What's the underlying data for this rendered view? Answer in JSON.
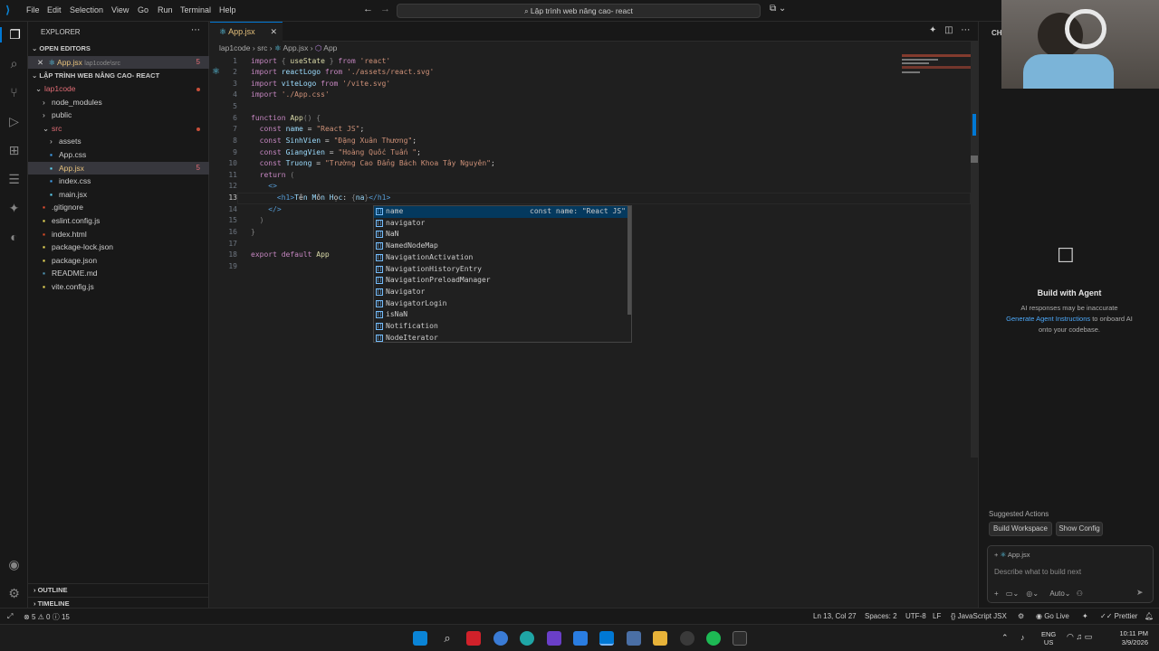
{
  "menu": {
    "items": [
      "File",
      "Edit",
      "Selection",
      "View",
      "Go",
      "Run",
      "Terminal",
      "Help"
    ],
    "search": "Lập trình web nâng cao- react"
  },
  "sidebar": {
    "title": "EXPLORER",
    "open_editors": "OPEN EDITORS",
    "open_file": "App.jsx",
    "open_file_path": "lap1code\\src",
    "open_file_badge": "5",
    "workspace": "LẬP TRÌNH WEB NÂNG CAO- REACT",
    "tree": [
      {
        "label": "lap1code",
        "type": "folder-open",
        "level": 1
      },
      {
        "label": "node_modules",
        "type": "folder",
        "level": 2
      },
      {
        "label": "public",
        "type": "folder",
        "level": 2
      },
      {
        "label": "src",
        "type": "folder-open",
        "level": 2
      },
      {
        "label": "assets",
        "type": "folder",
        "level": 3
      },
      {
        "label": "App.css",
        "type": "css",
        "level": 3
      },
      {
        "label": "App.jsx",
        "type": "jsx",
        "level": 3
      },
      {
        "label": "index.css",
        "type": "css",
        "level": 3
      },
      {
        "label": "main.jsx",
        "type": "jsx",
        "level": 3
      },
      {
        "label": ".gitignore",
        "type": "git",
        "level": 2
      },
      {
        "label": "eslint.config.js",
        "type": "js",
        "level": 2
      },
      {
        "label": "index.html",
        "type": "html",
        "level": 2
      },
      {
        "label": "package-lock.json",
        "type": "json",
        "level": 2
      },
      {
        "label": "package.json",
        "type": "json",
        "level": 2
      },
      {
        "label": "README.md",
        "type": "md",
        "level": 2
      },
      {
        "label": "vite.config.js",
        "type": "js",
        "level": 2
      }
    ],
    "badge": "5",
    "outline": "OUTLINE",
    "timeline": "TIMELINE"
  },
  "editor": {
    "tab": "App.jsx",
    "breadcrumb": [
      "lap1code",
      "src",
      "App.jsx",
      "App"
    ],
    "line_numbers": [
      "1",
      "2",
      "3",
      "4",
      "5",
      "6",
      "7",
      "8",
      "9",
      "10",
      "11",
      "12",
      "13",
      "14",
      "15",
      "16",
      "17",
      "18",
      "19"
    ],
    "code": [
      "import { useState } from 'react'",
      "import reactLogo from './assets/react.svg'",
      "import viteLogo from '/vite.svg'",
      "import './App.css'",
      "",
      "function App() {",
      "  const name = \"React JS\";",
      "  const SinhVien = \"Đặng Xuân Thương\";",
      "  const GiangVien = \"Hoàng Quốc Tuấn \";",
      "  const Truong = \"Trường Cao Đẳng Bách Khoa Tây Nguyên\";",
      "  return (",
      "    <>",
      "      <h1>Tên Môn Học: {na}</h1>",
      "    </>",
      "  )",
      "}",
      "",
      "export default App",
      ""
    ]
  },
  "suggest": {
    "items": [
      "name",
      "navigator",
      "NaN",
      "NamedNodeMap",
      "NavigationActivation",
      "NavigationHistoryEntry",
      "NavigationPreloadManager",
      "Navigator",
      "NavigatorLogin",
      "isNaN",
      "Notification",
      "NodeIterator"
    ],
    "detail": "const name: \"React JS\""
  },
  "agent_panel": {
    "header": "CHI",
    "title": "Build with Agent",
    "line1": "AI responses may be inaccurate",
    "link": "Generate Agent Instructions",
    "line2": "to onboard AI",
    "line3": "onto your codebase.",
    "suggested": "Suggested Actions",
    "chip1": "Build Workspace",
    "chip2": "Show Config",
    "context_file": "App.jsx",
    "placeholder": "Describe what to build next",
    "mode": "Auto"
  },
  "statusbar": {
    "problems_errors": "5",
    "problems_warnings": "0",
    "info": "15",
    "position": "Ln 13, Col 27",
    "spaces": "Spaces: 2",
    "encoding": "UTF-8",
    "eol": "LF",
    "language": "JavaScript JSX",
    "golive": "Go Live",
    "prettier": "Prettier"
  },
  "taskbar": {
    "lang": "ENG",
    "region": "US",
    "time": "10:11 PM",
    "date": "3/9/2026"
  }
}
